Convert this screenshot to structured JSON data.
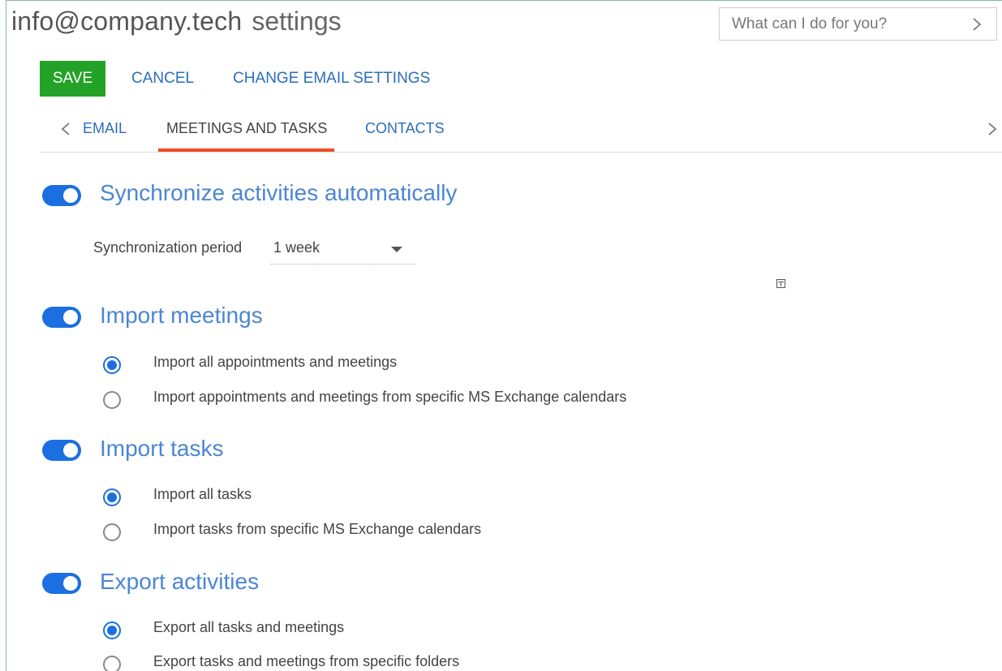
{
  "header": {
    "email": "info@company.tech",
    "suffix": "settings"
  },
  "search": {
    "placeholder": "What can I do for you?"
  },
  "toolbar": {
    "save_label": "SAVE",
    "cancel_label": "CANCEL",
    "change_email_label": "CHANGE EMAIL SETTINGS"
  },
  "tabs": [
    {
      "label": "EMAIL",
      "active": false
    },
    {
      "label": "MEETINGS AND TASKS",
      "active": true
    },
    {
      "label": "CONTACTS",
      "active": false
    }
  ],
  "sync": {
    "title": "Synchronize activities automatically",
    "enabled": true,
    "period_label": "Synchronization period",
    "period_value": "1 week"
  },
  "import_meetings": {
    "title": "Import meetings",
    "enabled": true,
    "options": [
      {
        "label": "Import all appointments and meetings",
        "checked": true
      },
      {
        "label": "Import appointments and meetings from specific MS Exchange calendars",
        "checked": false
      }
    ]
  },
  "import_tasks": {
    "title": "Import tasks",
    "enabled": true,
    "options": [
      {
        "label": "Import all tasks",
        "checked": true
      },
      {
        "label": "Import tasks from specific MS Exchange calendars",
        "checked": false
      }
    ]
  },
  "export_activities": {
    "title": "Export activities",
    "enabled": true,
    "options": [
      {
        "label": "Export all tasks and meetings",
        "checked": true
      },
      {
        "label": "Export tasks and meetings from specific folders",
        "checked": false
      }
    ]
  },
  "colors": {
    "accent_blue": "#1b6fe0",
    "link_blue": "#2a6ebb",
    "save_green": "#23a227",
    "tab_underline": "#f04e23",
    "title_blue": "#4a86d4"
  },
  "icons": [
    "chevron-right-icon",
    "chevron-left-icon",
    "window-icon"
  ]
}
